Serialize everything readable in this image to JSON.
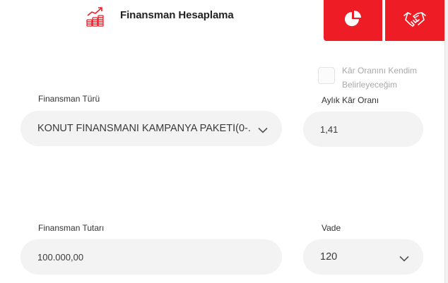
{
  "header": {
    "title": "Finansman Hesaplama",
    "icon": "finance-growth-icon"
  },
  "tabs": [
    {
      "icon": "pie-chart-icon",
      "color": "#ee1c25"
    },
    {
      "icon": "handshake-icon",
      "color": "#ee1c25"
    }
  ],
  "custom_rate": {
    "label": "Kâr Oranını Kendim Belirleyeceğim",
    "checked": false
  },
  "financing_type": {
    "label": "Finansman Türü",
    "value": "KONUT FİNANSMANI KAMPANYA PAKETİ(0-..."
  },
  "monthly_rate": {
    "label": "Aylık Kâr Oranı",
    "value": "1,41"
  },
  "financing_amount": {
    "label": "Finansman Tutarı",
    "value": "100.000,00"
  },
  "term": {
    "label": "Vade",
    "value": "120"
  },
  "colors": {
    "accent": "#ee1c25",
    "field_bg": "#f3f3f3"
  }
}
